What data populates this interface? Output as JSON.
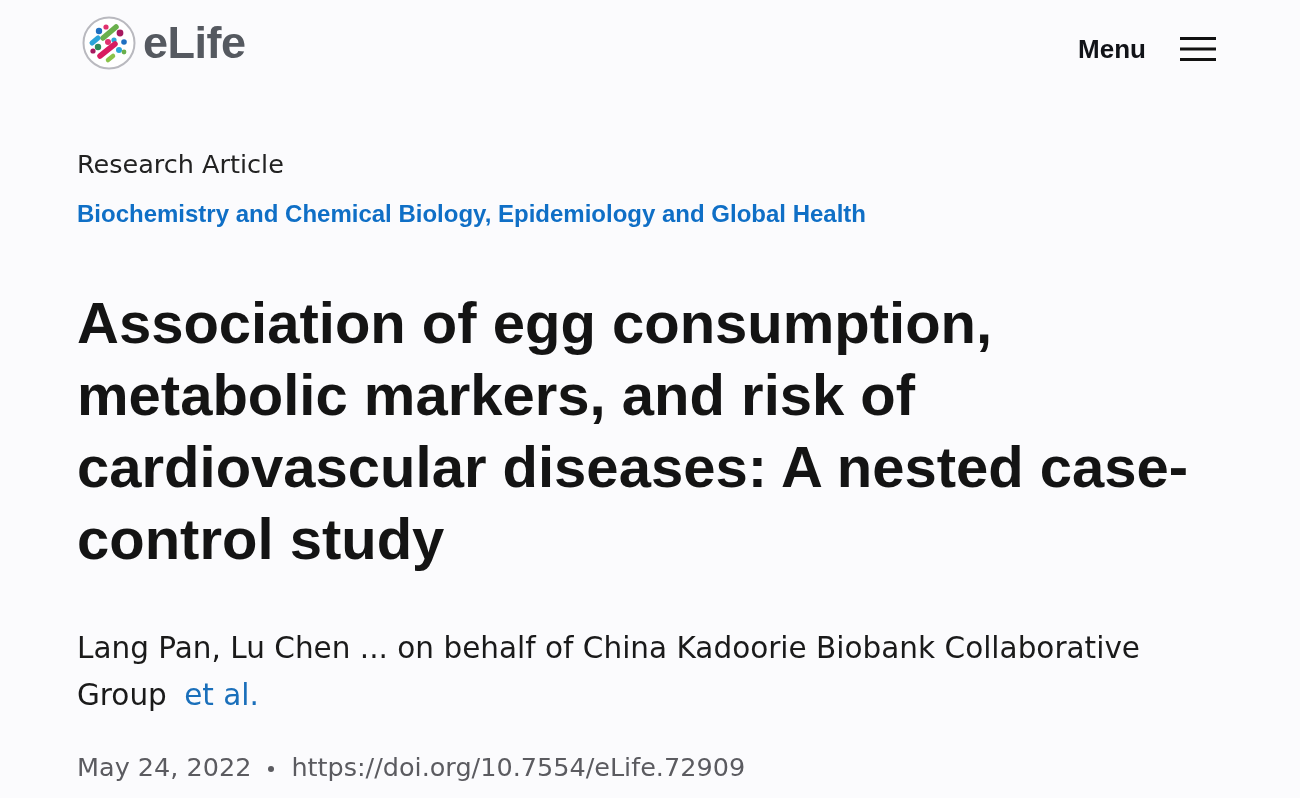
{
  "header": {
    "logo_text": "eLife",
    "menu_label": "Menu"
  },
  "article": {
    "type": "Research Article",
    "subjects": "Biochemistry and Chemical Biology, Epidemiology and Global Health",
    "title": "Association of egg consumption, metabolic markers, and risk of cardiovascular diseases: A nested case-control study",
    "authors": "Lang Pan, Lu Chen ... on behalf of China Kadoorie Biobank Collaborative Group",
    "authors_link": "et al.",
    "date": "May 24, 2022",
    "doi": "https://doi.org/10.7554/eLife.72909"
  }
}
